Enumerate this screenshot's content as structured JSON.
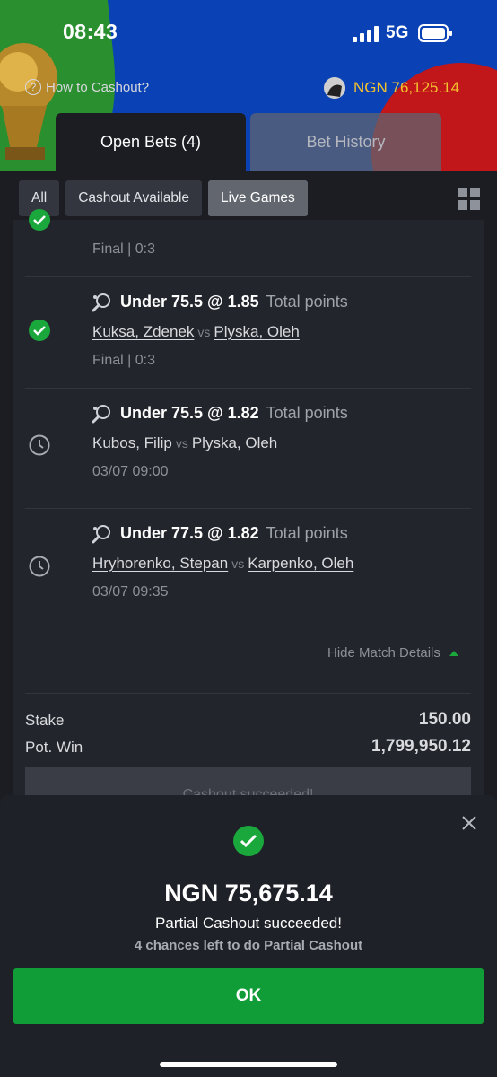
{
  "status_bar": {
    "time": "08:43",
    "network": "5G"
  },
  "header": {
    "how_to": "How to Cashout?",
    "balance": "NGN 76,125.14",
    "colors": {
      "blue": "#0a42b5",
      "green": "#2a8f2e",
      "red": "#c1161a",
      "balance": "#f2c12e"
    }
  },
  "tabs": {
    "open": "Open Bets (4)",
    "history": "Bet History"
  },
  "filters": [
    "All",
    "Cashout Available",
    "Live Games"
  ],
  "active_filter": "Live Games",
  "bets": [
    {
      "status": "won",
      "sport_icon": "table-tennis-icon",
      "pick": "",
      "market": "",
      "home": "",
      "away": "",
      "info": "Final | 0:3"
    },
    {
      "status": "won",
      "sport_icon": "table-tennis-icon",
      "pick": "Under 75.5 @ 1.85",
      "market": "Total points",
      "home": "Kuksa, Zdenek",
      "away": "Plyska, Oleh",
      "vs": "vs",
      "info": "Final | 0:3"
    },
    {
      "status": "pending",
      "sport_icon": "table-tennis-icon",
      "pick": "Under 75.5 @ 1.82",
      "market": "Total points",
      "home": "Kubos, Filip",
      "away": "Plyska, Oleh",
      "vs": "vs",
      "info": "03/07 09:00"
    },
    {
      "status": "pending",
      "sport_icon": "table-tennis-icon",
      "pick": "Under 77.5 @ 1.82",
      "market": "Total points",
      "home": "Hryhorenko, Stepan",
      "away": "Karpenko, Oleh",
      "vs": "vs",
      "info": "03/07 09:35"
    }
  ],
  "hide_details": "Hide Match Details",
  "stake_label": "Stake",
  "stake_value": "150.00",
  "potwin_label": "Pot. Win",
  "potwin_value": "1,799,950.12",
  "cashout_button": "Cashout succeeded!",
  "modal": {
    "amount": "NGN 75,675.14",
    "message": "Partial Cashout succeeded!",
    "chances": "4 chances left to do Partial Cashout",
    "ok": "OK",
    "accent": "#1aa83c"
  }
}
